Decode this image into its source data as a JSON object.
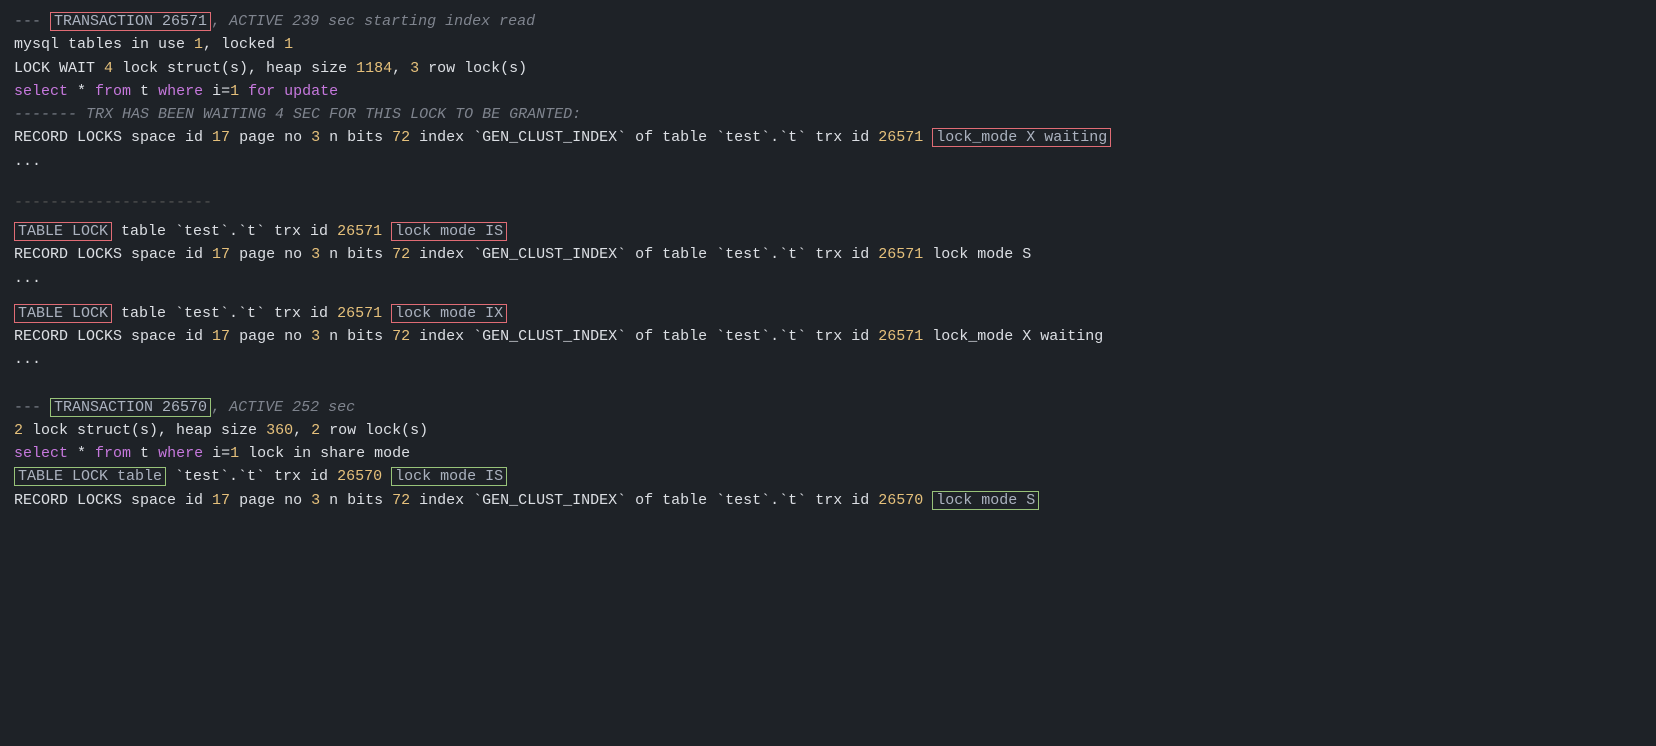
{
  "terminal": {
    "lines": []
  }
}
